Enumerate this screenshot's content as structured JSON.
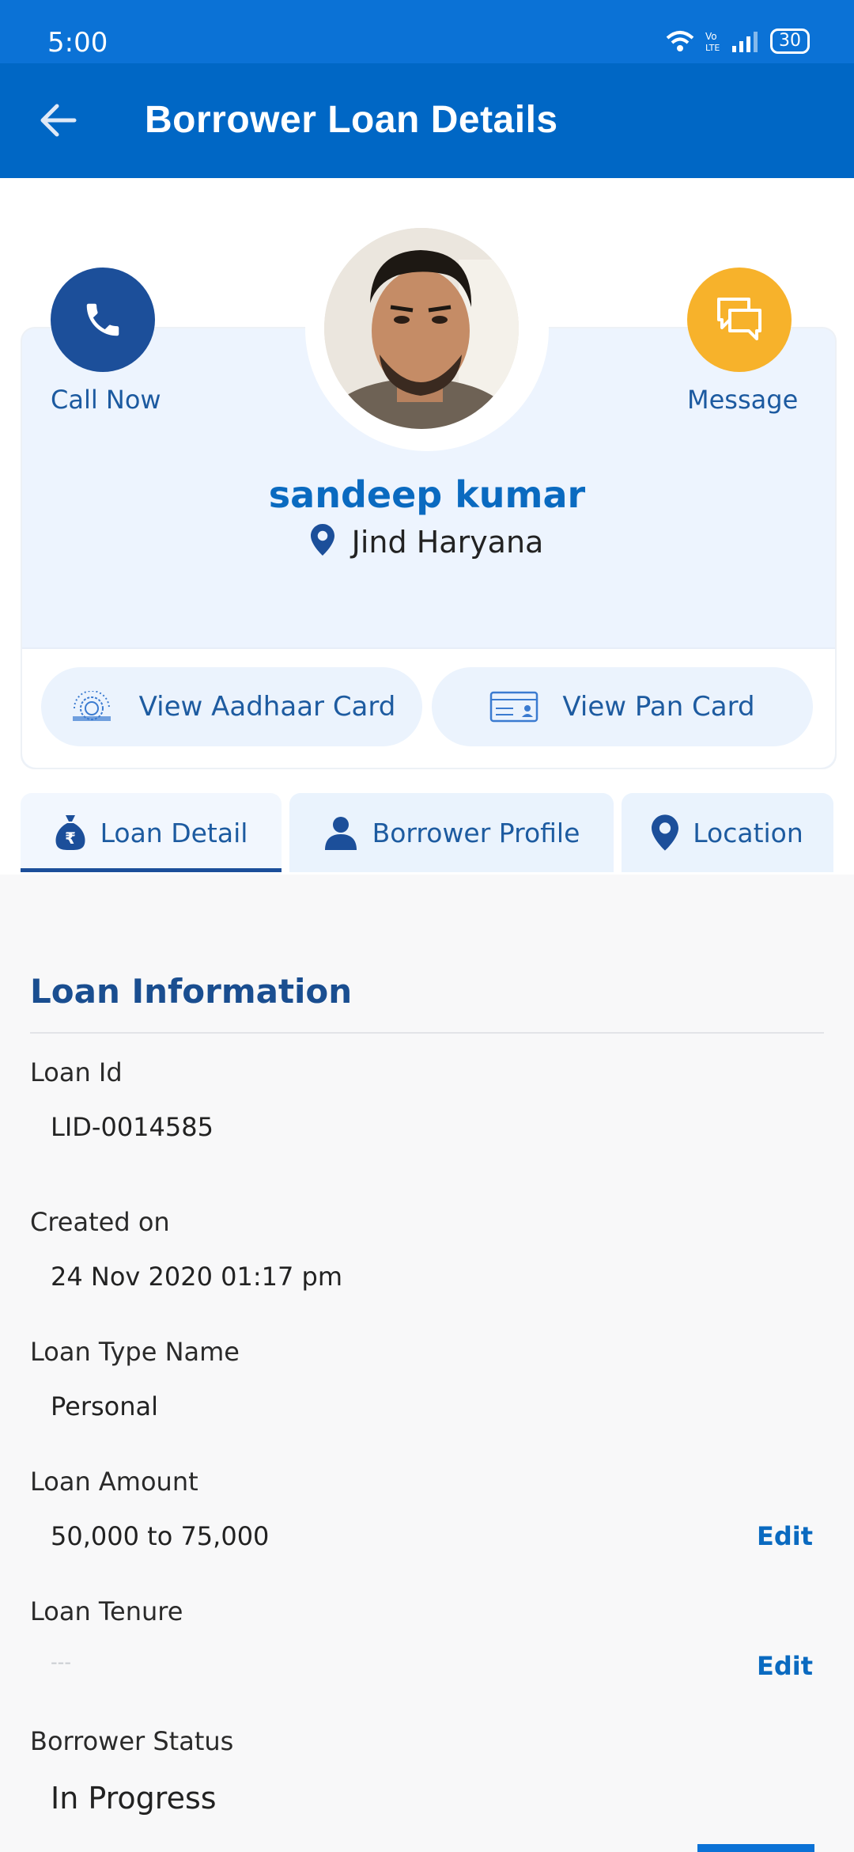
{
  "status_bar": {
    "time": "5:00",
    "battery": "30"
  },
  "app_bar": {
    "title": "Borrower Loan Details"
  },
  "profile": {
    "call_label": "Call Now",
    "message_label": "Message",
    "name": "sandeep kumar",
    "location": "Jind Haryana"
  },
  "documents": {
    "aadhaar_label": "View Aadhaar Card",
    "pan_label": "View Pan Card"
  },
  "tabs": [
    {
      "label": "Loan Detail",
      "active": true
    },
    {
      "label": "Borrower Profile",
      "active": false
    },
    {
      "label": "Location",
      "active": false
    }
  ],
  "loan_info": {
    "title": "Loan Information",
    "fields": [
      {
        "label": "Loan Id",
        "value": "LID-0014585"
      },
      {
        "label": "Created on",
        "value": "24 Nov 2020 01:17 pm"
      },
      {
        "label": "Loan Type Name",
        "value": "Personal"
      },
      {
        "label": "Loan Amount",
        "value": "50,000 to 75,000",
        "action": "Edit"
      },
      {
        "label": "Loan Tenure",
        "value": "---",
        "action": "Edit"
      },
      {
        "label": "Borrower Status",
        "value": "In Progress"
      }
    ]
  },
  "colors": {
    "primary": "#0067c5",
    "accent": "#f7b22b",
    "dark_blue": "#1c4f9a"
  }
}
